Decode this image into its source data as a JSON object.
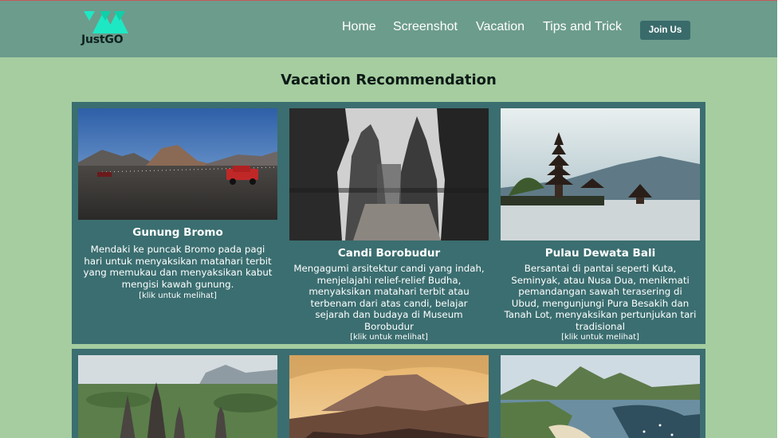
{
  "brand": {
    "logo_text": "JustGO"
  },
  "nav": {
    "links": [
      "Home",
      "Screenshot",
      "Vacation",
      "Tips and Trick"
    ],
    "cta": "Join Us"
  },
  "section": {
    "title": "Vacation Recommendation"
  },
  "destinations": [
    {
      "title": "Gunung Bromo",
      "desc": "Mendaki ke puncak Bromo pada pagi hari untuk menyaksikan matahari terbit yang memukau dan menyaksikan kabut mengisi kawah gunung.",
      "link": "[klik untuk melihat]"
    },
    {
      "title": "Candi Borobudur",
      "desc": "Mengagumi arsitektur candi yang indah, menjelajahi relief-relief Budha, menyaksikan matahari terbit atau terbenam dari atas candi, belajar sejarah dan budaya di Museum Borobudur",
      "link": "[klik untuk melihat]"
    },
    {
      "title": "Pulau Dewata Bali",
      "desc": "Bersantai di pantai seperti Kuta, Seminyak, atau Nusa Dua, menikmati pemandangan sawah terasering di Ubud, mengunjungi Pura Besakih dan Tanah Lot, menyaksikan pertunjukan tari tradisional",
      "link": "[klik untuk melihat]"
    }
  ],
  "colors": {
    "navbar": "#6c9c8c",
    "page_bg": "#a5cda0",
    "panel": "#3b6e70",
    "button": "#3a6b6b",
    "logo_accent": "#1ee8c4"
  }
}
